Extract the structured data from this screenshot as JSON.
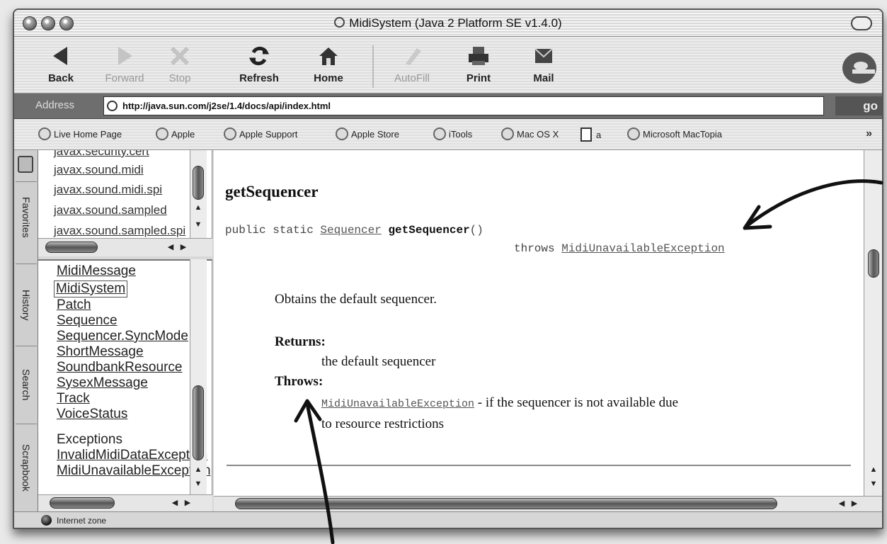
{
  "window": {
    "title": "MidiSystem (Java 2 Platform SE v1.4.0)"
  },
  "toolbar": {
    "buttons": [
      {
        "label": "Back",
        "icon": "back-arrow-icon",
        "enabled": true
      },
      {
        "label": "Forward",
        "icon": "forward-arrow-icon",
        "enabled": false
      },
      {
        "label": "Stop",
        "icon": "stop-x-icon",
        "enabled": false
      },
      {
        "label": "Refresh",
        "icon": "refresh-icon",
        "enabled": true
      },
      {
        "label": "Home",
        "icon": "home-icon",
        "enabled": true
      },
      {
        "label": "AutoFill",
        "icon": "autofill-icon",
        "enabled": false
      },
      {
        "label": "Print",
        "icon": "printer-icon",
        "enabled": true
      },
      {
        "label": "Mail",
        "icon": "mail-icon",
        "enabled": true
      }
    ]
  },
  "address": {
    "label": "Address",
    "url": "http://java.sun.com/j2se/1.4/docs/api/index.html",
    "go_label": "go"
  },
  "favorites": {
    "items": [
      "Live Home Page",
      "Apple",
      "Apple Support",
      "Apple Store",
      "iTools",
      "Mac OS X",
      "a",
      "Microsoft MacTopia"
    ],
    "more": "»"
  },
  "side_tabs": [
    "Favorites",
    "History",
    "Search",
    "Scrapbook"
  ],
  "packages": [
    "javax.security.cert",
    "javax.sound.midi",
    "javax.sound.midi.spi",
    "javax.sound.sampled",
    "javax.sound.sampled.spi"
  ],
  "classes": {
    "items": [
      "MidiMessage",
      "MidiSystem",
      "Patch",
      "Sequence",
      "Sequencer.SyncMode",
      "ShortMessage",
      "SoundbankResource",
      "SysexMessage",
      "Track",
      "VoiceStatus"
    ],
    "selected": "MidiSystem",
    "exceptions_heading": "Exceptions",
    "exceptions": [
      "InvalidMidiDataException",
      "MidiUnavailableException"
    ]
  },
  "doc": {
    "method_title": "getSequencer",
    "signature_modifiers": "public static ",
    "return_type": "Sequencer",
    "method_name": "getSequencer",
    "params": "()",
    "throws_kw": "throws ",
    "throws_type": "MidiUnavailableException",
    "description": "Obtains the default sequencer.",
    "returns_label": "Returns:",
    "returns_text": "the default sequencer",
    "throws_label": "Throws:",
    "exception_link": "MidiUnavailableException",
    "exception_desc_1": " - if the sequencer is not available due",
    "exception_desc_2": "to resource restrictions"
  },
  "status": {
    "text": "Internet zone"
  }
}
